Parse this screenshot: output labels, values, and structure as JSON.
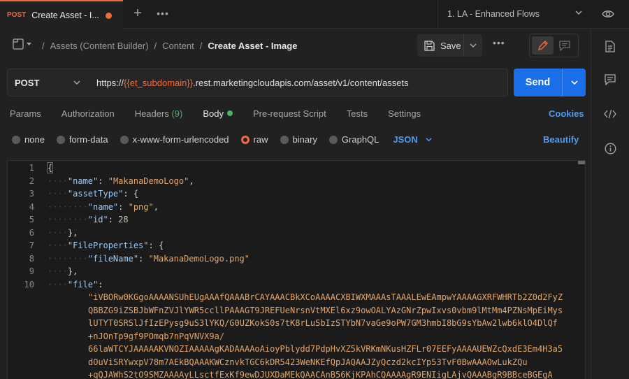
{
  "tabbar": {
    "active_tab": {
      "method": "POST",
      "title": "Create Asset - I..."
    },
    "environment": "1. LA - Enhanced Flows"
  },
  "breadcrumb": {
    "items": [
      "Assets (Content Builder)",
      "Content"
    ],
    "current": "Create Asset - Image",
    "save_label": "Save"
  },
  "request": {
    "method": "POST",
    "url_prefix": "https://",
    "url_variable": "{{et_subdomain}}",
    "url_suffix": ".rest.marketingcloudapis.com/asset/v1/content/assets",
    "send_label": "Send"
  },
  "tabs": {
    "params": "Params",
    "authorization": "Authorization",
    "headers": "Headers",
    "headers_count": "(9)",
    "body": "Body",
    "prerequest": "Pre-request Script",
    "tests": "Tests",
    "settings": "Settings",
    "cookies": "Cookies"
  },
  "body_types": {
    "none": "none",
    "form_data": "form-data",
    "urlencoded": "x-www-form-urlencoded",
    "raw": "raw",
    "binary": "binary",
    "graphql": "GraphQL",
    "language": "JSON",
    "beautify": "Beautify",
    "selected": "raw"
  },
  "editor": {
    "line_numbers": [
      "1",
      "2",
      "3",
      "4",
      "5",
      "6",
      "7",
      "8",
      "9",
      "10"
    ],
    "key_name": "\"name\"",
    "val_name": "\"MakanaDemoLogo\"",
    "key_assetType": "\"assetType\"",
    "key_name2": "\"name\"",
    "val_png": "\"png\"",
    "key_id": "\"id\"",
    "val_id": "28",
    "key_fileprops": "\"FileProperties\"",
    "key_filename": "\"fileName\"",
    "val_filename": "\"MakanaDemoLogo.png\"",
    "key_file": "\"file\"",
    "file_lines": [
      "\"iVBORw0KGgoAAAANSUhEUgAAAfQAAABrCAYAAACBkXCoAAAACXBIWXMAAAsTAAALEwEAmpwYAAAAGXRFWHRTb2Z0d2FyZ",
      "QBBZG9iZSBJbWFnZVJlYWR5ccllPAAAGT9JREFUeNrsnVtMXEl6xz9owOALYAzGNrZpwIxvs0vbm9lMtMm4PZNsMpEiMys",
      "lUTYT0SRSlJfIzEPysg9uS3lYKQ/G0UZKokS0s7tK8rLuSbIzSTYbN7vaGe9oPW7GM3hmbI8bG9sYbAw2lwb6klO4DlQf",
      "+nJOnTp9gf9POmqb7nPqVNVX9a/",
      "66laWTCYJAAAAAKVNOZIAAAAAgKADAAAAoAioyPblydd7PdpHvXZ5kVRKmNKusHZFLr07EEFyAAAAUEWZcQxdE3Em4H3a5",
      "dOuViSRYwxpV78m7AEkBQAAAKWCznvkTGC6kDR5423WeNKEfQpJAQAAJZyQczd2kcIYp53TvF0BwAAAOwLukZQu",
      "+qQJAWhS2tO9SMZAAAAyLLsctfExKf9ewDJUXDaMEkQAACAnB56KjKPAhCQAAAAgR9ENIigLAjvQAAABgR9BBceBGEgA"
    ]
  }
}
